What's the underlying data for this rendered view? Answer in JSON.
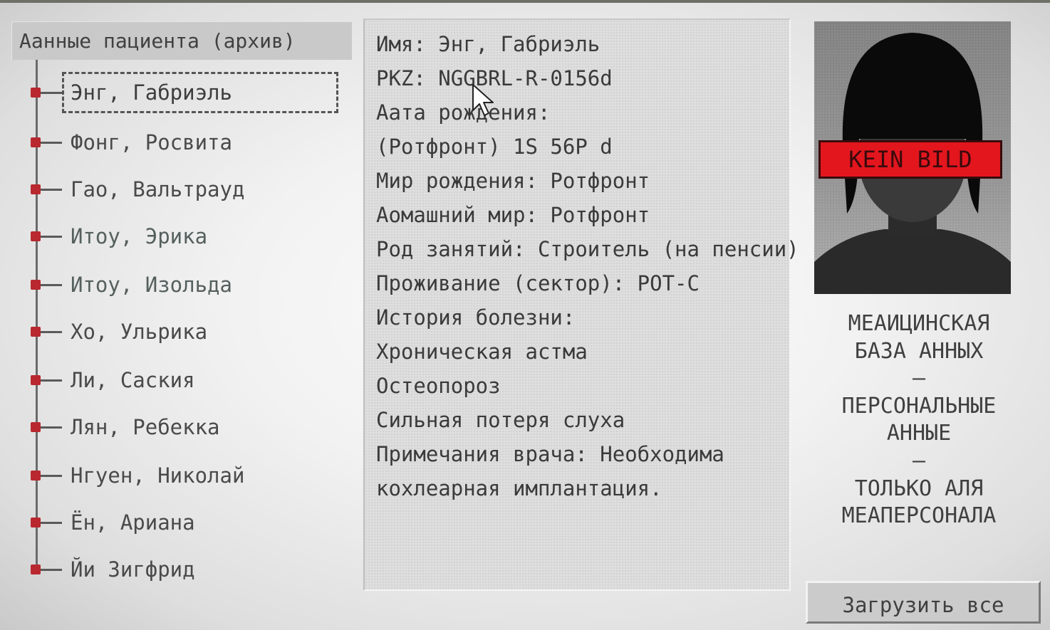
{
  "tree": {
    "header": "Аанные пациента (архив)",
    "items": [
      {
        "label": "Энг, Габриэль",
        "selected": true
      },
      {
        "label": "Фонг, Росвита"
      },
      {
        "label": "Гао, Вальтрауд"
      },
      {
        "label": "Итоу, Эрика"
      },
      {
        "label": "Итоу, Изольда"
      },
      {
        "label": "Хо, Ульрика"
      },
      {
        "label": "Ли, Саския"
      },
      {
        "label": "Лян, Ребекка"
      },
      {
        "label": "Нгуен, Николай"
      },
      {
        "label": "Ён, Ариана"
      },
      {
        "label": "Йи Зигфрид"
      }
    ]
  },
  "detail": {
    "lines": [
      "Имя: Энг, Габриэль",
      "PKZ: NGGBRL-R-0156d",
      "Аата рождения:",
      "(Ротфронт) 1S 56P d",
      "Мир рождения: Ротфронт",
      "Аомашний мир: Ротфронт",
      "Род занятий: Строитель (на пенсии)",
      "Проживание (сектор): РОТ-С",
      "История болезни:",
      "Хроническая астма",
      "Остеопороз",
      "Сильная потеря слуха",
      "Примечания врача: Необходима",
      "кохлеарная имплантация."
    ]
  },
  "photo": {
    "label": "KEIN BILD",
    "label_color": "#e3161e"
  },
  "caption": {
    "lines": [
      "МЕАИЦИНСКАЯ",
      "БАЗА АННЫХ",
      "–",
      "ПЕРСОНАЛЬНЫЕ",
      "АННЫЕ",
      "–",
      "ТОЛЬКО АЛЯ",
      "МЕАПЕРСОНАЛА"
    ]
  },
  "buttons": {
    "load_all": "Загрузить все"
  }
}
